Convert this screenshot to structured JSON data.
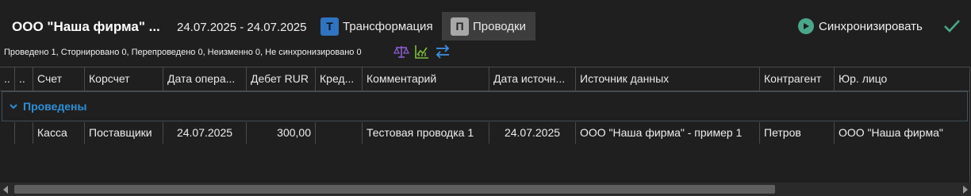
{
  "header": {
    "title": "ООО \"Наша фирма\" ...",
    "date_range": "24.07.2025 - 24.07.2025",
    "tab_transform": {
      "icon_letter": "Т",
      "label": "Трансформация",
      "icon_color": "#2f74c0"
    },
    "tab_posts": {
      "icon_letter": "П",
      "label": "Проводки",
      "active": true
    },
    "sync_label": "Синхронизировать",
    "accent_color": "#4aa88a"
  },
  "status": {
    "text": "Проведено 1, Сторнировано 0, Перепроведено 0, Неизменно 0, Не синхронизировано 0",
    "icons": [
      "balance-scale-icon",
      "chart-growth-icon",
      "swap-arrows-icon"
    ]
  },
  "grid": {
    "columns": [
      "..",
      "..",
      "Счет",
      "Корсчет",
      "Дата опера...",
      "Дебет RUR",
      "Кред...",
      "Комментарий",
      "Дата источн...",
      "Источник данных",
      "Контрагент",
      "Юр. лицо"
    ],
    "group_label": "Проведены",
    "rows": [
      [
        "",
        "",
        "Касса",
        "Поставщики",
        "24.07.2025",
        "300,00",
        "",
        "Тестовая проводка 1",
        "24.07.2025",
        "ООО \"Наша фирма\" - пример 1",
        "Петров",
        "ООО \"Наша фирма\""
      ]
    ]
  }
}
